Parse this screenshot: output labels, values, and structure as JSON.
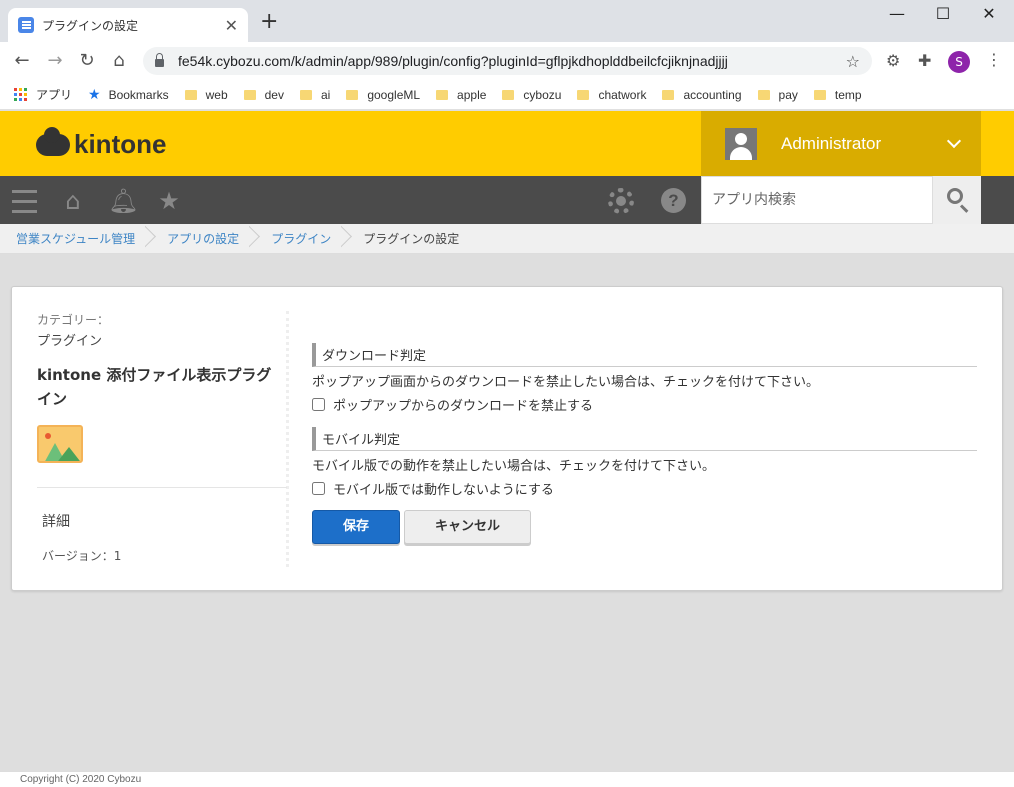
{
  "browser": {
    "tab_title": "プラグインの設定",
    "url": "fe54k.cybozu.com/k/admin/app/989/plugin/config?pluginId=gflpjkdhoplddbeilcfcjiknjnadjjjj",
    "profile_initial": "S",
    "bookmarks": [
      {
        "label": "アプリ",
        "icon": "apps-icon"
      },
      {
        "label": "Bookmarks",
        "icon": "star-icon"
      },
      {
        "label": "web",
        "icon": "folder-icon"
      },
      {
        "label": "dev",
        "icon": "folder-icon"
      },
      {
        "label": "ai",
        "icon": "folder-icon"
      },
      {
        "label": "googleML",
        "icon": "folder-icon"
      },
      {
        "label": "apple",
        "icon": "folder-icon"
      },
      {
        "label": "cybozu",
        "icon": "folder-icon"
      },
      {
        "label": "chatwork",
        "icon": "folder-icon"
      },
      {
        "label": "accounting",
        "icon": "folder-icon"
      },
      {
        "label": "pay",
        "icon": "folder-icon"
      },
      {
        "label": "temp",
        "icon": "folder-icon"
      }
    ]
  },
  "header": {
    "logo": "kintone",
    "username": "Administrator",
    "search_placeholder": "アプリ内検索",
    "brand_color": "#ffcc00"
  },
  "breadcrumb": [
    "営業スケジュール管理",
    "アプリの設定",
    "プラグイン",
    "プラグインの設定"
  ],
  "plugin": {
    "category_label": "カテゴリー：",
    "category_value": "プラグイン",
    "name": "kintone 添付ファイル表示プラグイン",
    "detail": "詳細",
    "version": "バージョン：1"
  },
  "settings": {
    "download": {
      "title": "ダウンロード判定",
      "description": "ポップアップ画面からのダウンロードを禁止したい場合は、チェックを付けて下さい。",
      "checkbox_label": "ポップアップからのダウンロードを禁止する"
    },
    "mobile": {
      "title": "モバイル判定",
      "description": "モバイル版での動作を禁止したい場合は、チェックを付けて下さい。",
      "checkbox_label": "モバイル版では動作しないようにする"
    },
    "save_label": "保存",
    "cancel_label": "キャンセル"
  },
  "footer": "Copyright (C) 2020 Cybozu"
}
